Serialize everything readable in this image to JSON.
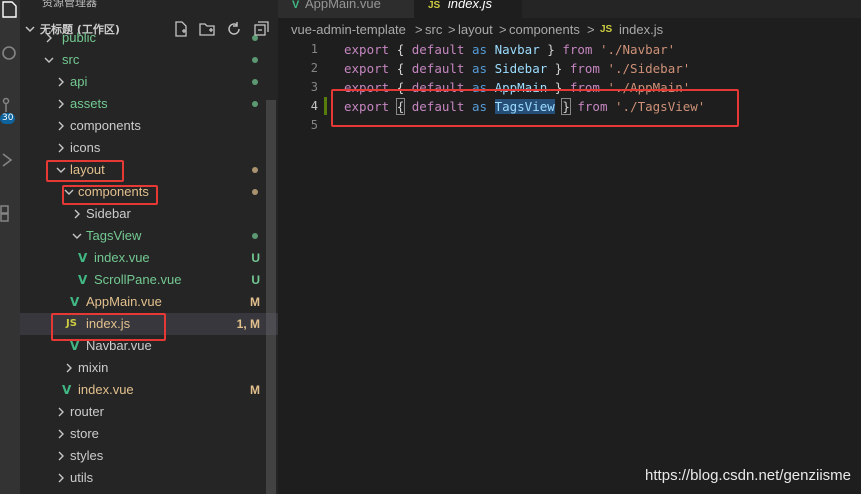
{
  "sidebar": {
    "title": "资源管理器",
    "workspace": "无标题 (工作区)",
    "tree": [
      {
        "label": "public",
        "kind": "folder",
        "color": "#73c991"
      },
      {
        "label": "src",
        "kind": "folder",
        "color": "#73c991"
      },
      {
        "label": "api",
        "kind": "folder",
        "color": "#73c991"
      },
      {
        "label": "assets",
        "kind": "folder",
        "color": "#73c991"
      },
      {
        "label": "components",
        "kind": "folder",
        "color": "#cccccc"
      },
      {
        "label": "icons",
        "kind": "folder",
        "color": "#cccccc"
      },
      {
        "label": "layout",
        "kind": "folder",
        "color": "#e2c08d"
      },
      {
        "label": "components",
        "kind": "folder",
        "color": "#e2c08d"
      },
      {
        "label": "Sidebar",
        "kind": "folder",
        "color": "#cccccc"
      },
      {
        "label": "TagsView",
        "kind": "folder",
        "color": "#73c991"
      },
      {
        "label": "index.vue",
        "kind": "vue",
        "color": "#73c991",
        "status": "U"
      },
      {
        "label": "ScrollPane.vue",
        "kind": "vue",
        "color": "#73c991",
        "status": "U"
      },
      {
        "label": "AppMain.vue",
        "kind": "vue",
        "color": "#e2c08d",
        "status": "M"
      },
      {
        "label": "index.js",
        "kind": "js",
        "color": "#e2c08d",
        "status": "1, M"
      },
      {
        "label": "Navbar.vue",
        "kind": "vue",
        "color": "#cccccc"
      },
      {
        "label": "mixin",
        "kind": "folder",
        "color": "#cccccc"
      },
      {
        "label": "index.vue",
        "kind": "vue",
        "color": "#e2c08d",
        "status": "M"
      },
      {
        "label": "router",
        "kind": "folder",
        "color": "#cccccc"
      },
      {
        "label": "store",
        "kind": "folder",
        "color": "#cccccc"
      },
      {
        "label": "styles",
        "kind": "folder",
        "color": "#cccccc"
      },
      {
        "label": "utils",
        "kind": "folder",
        "color": "#cccccc"
      }
    ],
    "vue_icon_glyph": "V",
    "js_icon_glyph": "JS"
  },
  "activity": {
    "badge": "30"
  },
  "tabs": [
    {
      "label": "AppMain.vue",
      "active": false,
      "icon": "V"
    },
    {
      "label": "index.js",
      "active": true,
      "icon": "JS"
    }
  ],
  "breadcrumb": {
    "parts": [
      "vue-admin-template",
      "src",
      "layout",
      "components"
    ],
    "file_icon": "JS",
    "file": "index.js",
    "separator": ">"
  },
  "editor": {
    "line_numbers": [
      "1",
      "2",
      "3",
      "4",
      "5"
    ],
    "keywords": {
      "export": "export",
      "default": "default",
      "as": "as",
      "from": "from"
    },
    "lines": [
      {
        "name": "Navbar",
        "path": "'./Navbar'"
      },
      {
        "name": "Sidebar",
        "path": "'./Sidebar'"
      },
      {
        "name": "AppMain",
        "path": "'./AppMain'"
      },
      {
        "name": "TagsView",
        "path": "'./TagsView'"
      }
    ],
    "brace_open": "{",
    "brace_close": "}"
  },
  "watermark": "https://blog.csdn.net/genziisme",
  "colors": {
    "accent_red": "#e53935",
    "added": "#73c991",
    "modified": "#e2c08d",
    "js_icon": "#cbcb41",
    "vue_icon": "#41b883"
  }
}
